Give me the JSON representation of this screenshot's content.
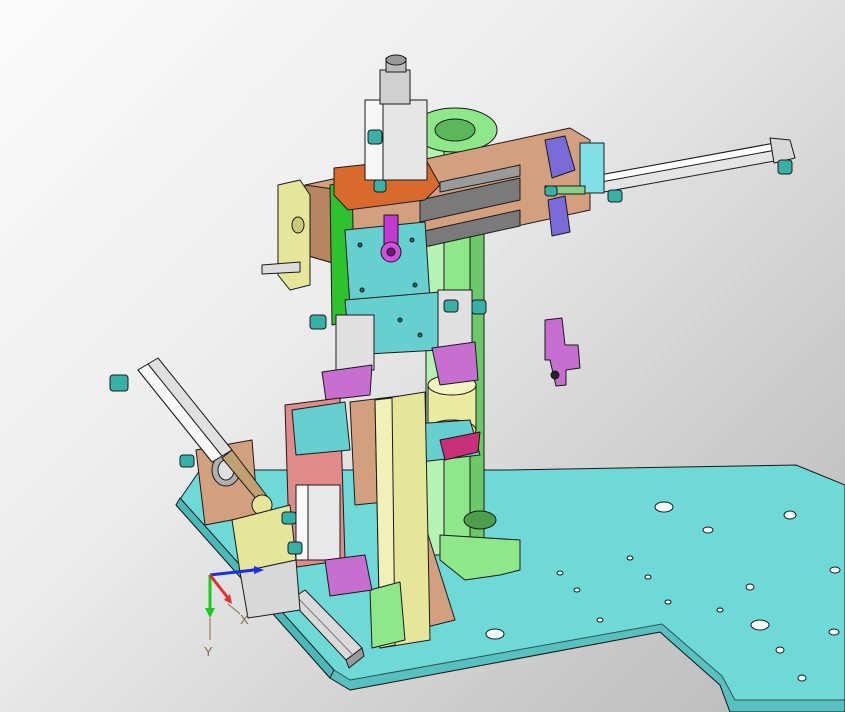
{
  "viewport": {
    "background_top": "#fbfbfb",
    "background_bottom": "#b9b9b9"
  },
  "triad": {
    "x_label": "X",
    "y_label": "Y",
    "x_color": "#e03030",
    "y_color": "#1ec81e",
    "z_color": "#1a2fe0"
  },
  "colors": {
    "base_plate": "#6fd9d8",
    "column": "#8ee889",
    "bracket_tan": "#d3a07f",
    "bracket_yellow": "#e6e69a",
    "slide_cyan": "#66cfd0",
    "cylinder_silver": "#dcdcdc",
    "fitting_teal": "#38b0a8",
    "clamp_magenta": "#c66fd0",
    "stop_purple": "#7b6bd8",
    "mount_orange": "#d86a2e",
    "outline": "#1a1a1a"
  },
  "icons": {
    "triad": "xyz-triad-icon"
  }
}
